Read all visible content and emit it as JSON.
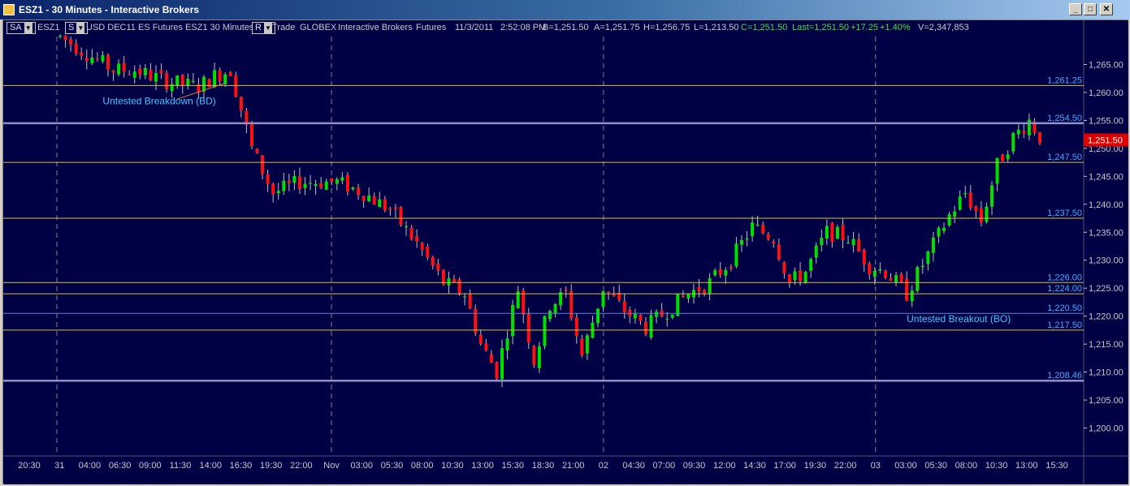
{
  "window": {
    "title": "ESZ1 - 30 Minutes - Interactive Brokers",
    "buttons": {
      "minimize": "_",
      "maximize": "□",
      "close": "✕"
    }
  },
  "infobar": {
    "layout_dropdown": "SA",
    "symbol": "ESZ1",
    "s_dropdown": "S",
    "description": "USD DEC11 ES Futures ESZ1  30 Minutes",
    "r_dropdown": "R",
    "trade": "Trade",
    "exchange": "GLOBEX",
    "broker": "Interactive Brokers",
    "type": "Futures",
    "date": "11/3/2011",
    "time": "2:52:08 PM",
    "bid": "B=1,251.50",
    "ask": "A=1,251.75",
    "high": "H=1,256.75",
    "low": "L=1,213.50",
    "close": "C=1,251.50",
    "last": "Last=1,251.50",
    "change": "+17.25",
    "change_pct": "+1.40%",
    "volume": "V=2,347,853"
  },
  "colors": {
    "background": "#000044",
    "up_candle": "#00e000",
    "down_candle": "#ff1010",
    "level_line": "#d4c040",
    "major_line": "#9090c8",
    "level_label": "#40b0ff",
    "annotation": "#40c8ff",
    "price_badge": "#e00000",
    "axis_text": "#c8c8c8"
  },
  "chart_data": {
    "type": "candlestick",
    "ylim": [
      1195,
      1270
    ],
    "yticks": [
      {
        "v": 1265,
        "label": "1,265.00"
      },
      {
        "v": 1260,
        "label": "1,260.00"
      },
      {
        "v": 1255,
        "label": "1,255.00"
      },
      {
        "v": 1250,
        "label": "1,250.00"
      },
      {
        "v": 1245,
        "label": "1,245.00"
      },
      {
        "v": 1240,
        "label": "1,240.00"
      },
      {
        "v": 1235,
        "label": "1,235.00"
      },
      {
        "v": 1230,
        "label": "1,230.00"
      },
      {
        "v": 1225,
        "label": "1,225.00"
      },
      {
        "v": 1220,
        "label": "1,220.00"
      },
      {
        "v": 1215,
        "label": "1,215.00"
      },
      {
        "v": 1210,
        "label": "1,210.00"
      },
      {
        "v": 1205,
        "label": "1,205.00"
      },
      {
        "v": 1200,
        "label": "1,200.00"
      }
    ],
    "xticks": [
      "20:30",
      "31",
      "04:00",
      "06:30",
      "09:00",
      "11:30",
      "14:00",
      "16:30",
      "19:30",
      "22:00",
      "Nov",
      "03:00",
      "05:30",
      "08:00",
      "10:30",
      "13:00",
      "15:30",
      "18:30",
      "21:00",
      "02",
      "04:30",
      "07:00",
      "09:30",
      "12:00",
      "14:30",
      "17:00",
      "19:30",
      "22:00",
      "03",
      "03:00",
      "05:30",
      "08:00",
      "10:30",
      "13:00",
      "15:30"
    ],
    "session_breaks": [
      2,
      10,
      19,
      28
    ],
    "levels": [
      {
        "price": 1261.25,
        "label": "1,261.25",
        "style": "thin"
      },
      {
        "price": 1254.5,
        "label": "1,254.50",
        "style": "major"
      },
      {
        "price": 1247.5,
        "label": "1,247.50",
        "style": "thin"
      },
      {
        "price": 1237.5,
        "label": "1,237.50",
        "style": "thin"
      },
      {
        "price": 1226.0,
        "label": "1,226.00",
        "style": "thin"
      },
      {
        "price": 1224.0,
        "label": "1,224.00",
        "style": "thin"
      },
      {
        "price": 1220.5,
        "label": "1,220.50",
        "style": "blue"
      },
      {
        "price": 1217.5,
        "label": "1,217.50",
        "style": "thin"
      },
      {
        "price": 1208.46,
        "label": "1,208.46",
        "style": "major"
      }
    ],
    "last_price": {
      "value": 1251.5,
      "label": "1,251.50"
    },
    "annotations": [
      {
        "text": "Untested Breakdown (BD)",
        "price": 1258.5,
        "bar": 11
      },
      {
        "text": "Untested Breakout (BO)",
        "price": 1219.5,
        "bar": 159
      }
    ],
    "path": [
      [
        0,
        1270
      ],
      [
        10,
        1264
      ],
      [
        14,
        1264
      ],
      [
        20,
        1262
      ],
      [
        26,
        1261
      ],
      [
        29,
        1263
      ],
      [
        32,
        1264
      ],
      [
        36,
        1250
      ],
      [
        40,
        1242
      ],
      [
        45,
        1244
      ],
      [
        48,
        1244
      ],
      [
        52,
        1244
      ],
      [
        57,
        1242
      ],
      [
        62,
        1239
      ],
      [
        67,
        1233
      ],
      [
        72,
        1226
      ],
      [
        76,
        1224
      ],
      [
        79,
        1215
      ],
      [
        82,
        1210
      ],
      [
        86,
        1225
      ],
      [
        89,
        1212
      ],
      [
        92,
        1222
      ],
      [
        95,
        1224
      ],
      [
        98,
        1213
      ],
      [
        102,
        1225
      ],
      [
        106,
        1221
      ],
      [
        110,
        1218
      ],
      [
        114,
        1221
      ],
      [
        118,
        1224
      ],
      [
        122,
        1226
      ],
      [
        126,
        1230
      ],
      [
        130,
        1236
      ],
      [
        134,
        1234
      ],
      [
        137,
        1226
      ],
      [
        140,
        1228
      ],
      [
        144,
        1235
      ],
      [
        148,
        1234
      ],
      [
        152,
        1229
      ],
      [
        155,
        1228
      ],
      [
        159,
        1224
      ],
      [
        163,
        1231
      ],
      [
        167,
        1238
      ],
      [
        170,
        1242
      ],
      [
        173,
        1237
      ],
      [
        176,
        1247
      ],
      [
        179,
        1252
      ],
      [
        182,
        1255
      ],
      [
        184,
        1252
      ]
    ]
  }
}
